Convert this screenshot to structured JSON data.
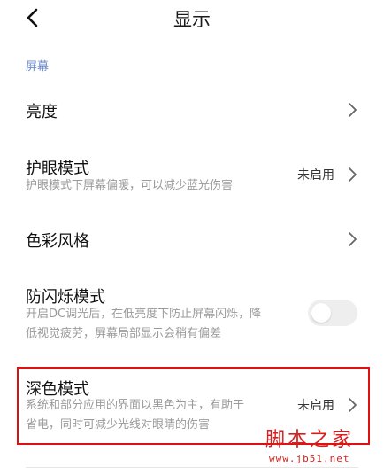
{
  "header": {
    "title": "显示",
    "back_icon": "back-arrow-icon"
  },
  "section_label": "屏幕",
  "rows": [
    {
      "title": "亮度"
    },
    {
      "title": "护眼模式",
      "subtitle": "护眼模式下屏幕偏暖，可以减少蓝光伤害",
      "status": "未启用"
    },
    {
      "title": "色彩风格"
    },
    {
      "title": "防闪烁模式",
      "subtitle_lines": [
        "开启DC调光后，在低亮度下防止屏幕闪烁，降",
        "低视觉疲劳，屏幕局部显示会稍有偏差"
      ],
      "toggle_on": false
    },
    {
      "title": "深色模式",
      "subtitle_lines": [
        "系统和部分应用的界面以黑色为主，有助于",
        "省电，同时可减少光线对眼睛的伤害"
      ],
      "status": "未启用"
    }
  ],
  "watermark": {
    "text": "脚本之家",
    "url": "www.jb51.net"
  },
  "colors": {
    "section_label": "#6b8bd0",
    "highlight_border": "#e01010",
    "watermark": "#d81e1e"
  }
}
